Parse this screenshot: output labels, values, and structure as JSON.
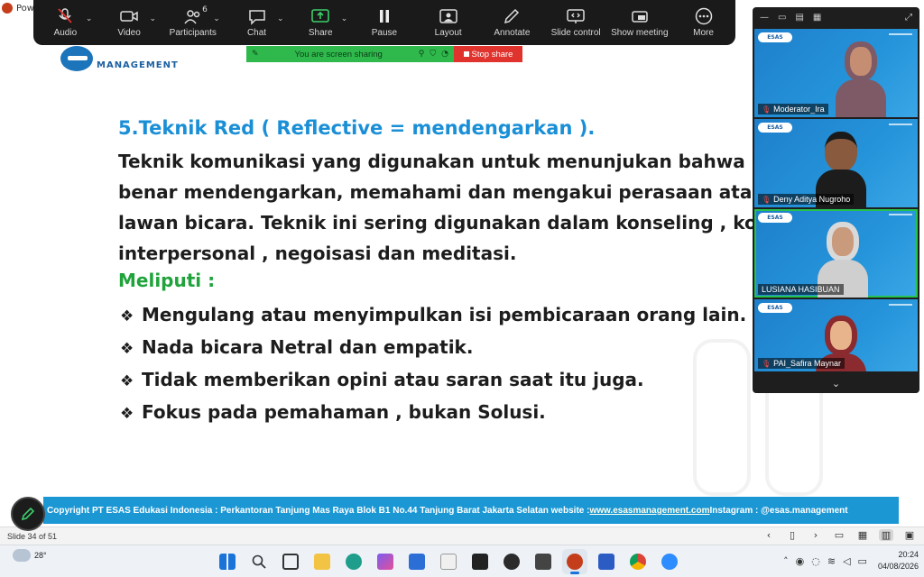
{
  "app": {
    "title": "Pow"
  },
  "toolbar": {
    "items": [
      {
        "label": "Audio",
        "icon": "mic-muted-icon"
      },
      {
        "label": "Video",
        "icon": "video-camera-icon"
      },
      {
        "label": "Participants",
        "icon": "participants-icon",
        "count": "6"
      },
      {
        "label": "Chat",
        "icon": "chat-icon"
      },
      {
        "label": "Share",
        "icon": "share-screen-icon"
      },
      {
        "label": "Pause",
        "icon": "pause-icon"
      },
      {
        "label": "Layout",
        "icon": "layout-icon"
      },
      {
        "label": "Annotate",
        "icon": "pencil-icon"
      },
      {
        "label": "Slide control",
        "icon": "slide-control-icon"
      },
      {
        "label": "Show meeting",
        "icon": "show-meeting-icon"
      },
      {
        "label": "More",
        "icon": "more-icon"
      }
    ]
  },
  "share_banner": {
    "text": "You are screen sharing",
    "stop_label": "Stop share"
  },
  "slide": {
    "logo_text": "MANAGEMENT",
    "heading": "5.Teknik Red ( Reflective = mendengarkan ).",
    "body_lines": [
      "Teknik komunikasi yang digunakan untuk menunjukan bahwa kita b",
      "benar mendengarkan, memahami dan mengakui perasaan atau per",
      "lawan bicara. Teknik ini sering digunakan dalam konseling , komu",
      "interpersonal , negoisasi dan meditasi."
    ],
    "subheading": "Meliputi :",
    "bullets": [
      "Mengulang atau menyimpulkan isi pembicaraan orang lain.",
      "Nada bicara Netral dan empatik.",
      "Tidak memberikan opini atau saran saat itu juga.",
      "Fokus pada pemahaman , bukan Solusi."
    ],
    "bullet_symbol": "❖",
    "footer": {
      "prefix": "Copyright PT ESAS Edukasi Indonesia : Perkantoran Tanjung Mas Raya Blok B1 No.44 Tanjung Barat Jakarta Selatan website : ",
      "link": "www.esasmanagement.com",
      "suffix": " Instagram : @esas.management"
    }
  },
  "status": {
    "slide_indicator": "Slide 34 of 51"
  },
  "taskbar": {
    "temperature": "28°",
    "time": "20:24",
    "date": "04/08/2026"
  },
  "gallery": {
    "tile_logo": "ESAS",
    "participants": [
      {
        "name": "Moderator_Ira",
        "muted": true,
        "speaking": false
      },
      {
        "name": "Deny Aditya Nugroho",
        "muted": true,
        "speaking": false
      },
      {
        "name": "LUSIANA HASIBUAN",
        "muted": false,
        "speaking": true
      },
      {
        "name": "PAI_Safira Maynar",
        "muted": true,
        "speaking": false
      }
    ]
  },
  "colors": {
    "heading": "#1a8fd6",
    "subheading": "#21a33c",
    "footer_bar": "#1b97d4",
    "share_green": "#2fb84c",
    "stop_red": "#e0332d",
    "speaking_outline": "#26c24f"
  }
}
